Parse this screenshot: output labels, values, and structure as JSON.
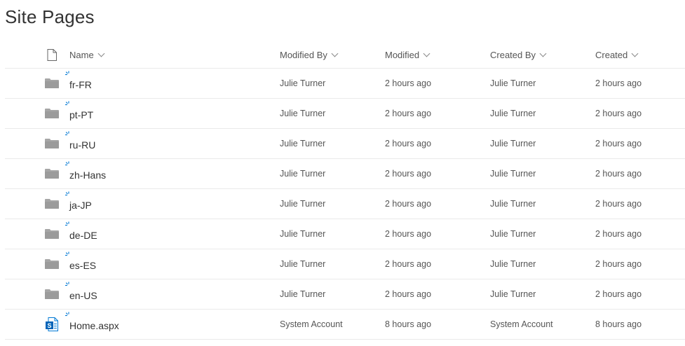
{
  "page": {
    "title": "Site Pages"
  },
  "columns": {
    "type_icon": "document-icon",
    "name": "Name",
    "modified_by": "Modified By",
    "modified": "Modified",
    "created_by": "Created By",
    "created": "Created"
  },
  "rows": [
    {
      "type": "folder",
      "name": "fr-FR",
      "modified_by": "Julie Turner",
      "modified": "2 hours ago",
      "created_by": "Julie Turner",
      "created": "2 hours ago"
    },
    {
      "type": "folder",
      "name": "pt-PT",
      "modified_by": "Julie Turner",
      "modified": "2 hours ago",
      "created_by": "Julie Turner",
      "created": "2 hours ago"
    },
    {
      "type": "folder",
      "name": "ru-RU",
      "modified_by": "Julie Turner",
      "modified": "2 hours ago",
      "created_by": "Julie Turner",
      "created": "2 hours ago"
    },
    {
      "type": "folder",
      "name": "zh-Hans",
      "modified_by": "Julie Turner",
      "modified": "2 hours ago",
      "created_by": "Julie Turner",
      "created": "2 hours ago"
    },
    {
      "type": "folder",
      "name": "ja-JP",
      "modified_by": "Julie Turner",
      "modified": "2 hours ago",
      "created_by": "Julie Turner",
      "created": "2 hours ago"
    },
    {
      "type": "folder",
      "name": "de-DE",
      "modified_by": "Julie Turner",
      "modified": "2 hours ago",
      "created_by": "Julie Turner",
      "created": "2 hours ago"
    },
    {
      "type": "folder",
      "name": "es-ES",
      "modified_by": "Julie Turner",
      "modified": "2 hours ago",
      "created_by": "Julie Turner",
      "created": "2 hours ago"
    },
    {
      "type": "folder",
      "name": "en-US",
      "modified_by": "Julie Turner",
      "modified": "2 hours ago",
      "created_by": "Julie Turner",
      "created": "2 hours ago"
    },
    {
      "type": "sharepoint-page",
      "name": "Home.aspx",
      "modified_by": "System Account",
      "modified": "8 hours ago",
      "created_by": "System Account",
      "created": "8 hours ago"
    }
  ],
  "icons": {
    "folder": "folder-icon",
    "sharepoint-page": "sharepoint-page-icon",
    "new_badge": "new-item-sparkle-icon",
    "sort": "chevron-down-icon"
  },
  "colors": {
    "folder": "#a6a6a6",
    "sharepoint_blue": "#0078d4",
    "new_badge": "#0078d4",
    "text": "#333333",
    "divider": "#eaeaea"
  }
}
